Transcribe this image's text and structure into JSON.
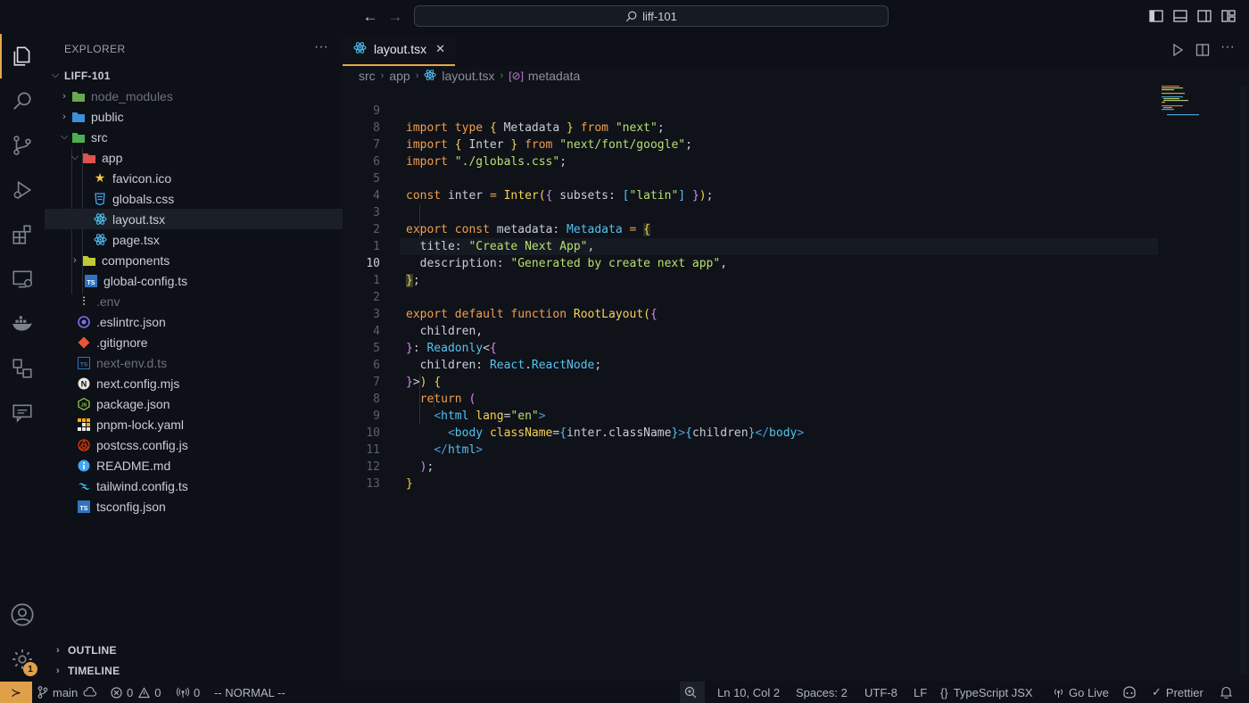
{
  "titlebar": {
    "search_text": "liff-101"
  },
  "activity": {
    "settings_badge": "1"
  },
  "explorer": {
    "title": "EXPLORER",
    "project": "LIFF-101",
    "items": [
      {
        "label": "node_modules",
        "icon": "folder-node-icon",
        "dim": true
      },
      {
        "label": "public",
        "icon": "folder-public-icon",
        "dim": false
      },
      {
        "label": "src",
        "icon": "folder-src-icon",
        "dim": false
      },
      {
        "label": "app",
        "icon": "folder-app-icon",
        "dim": false
      },
      {
        "label": "favicon.ico",
        "icon": "star-icon",
        "dim": false
      },
      {
        "label": "globals.css",
        "icon": "css-icon",
        "dim": false
      },
      {
        "label": "layout.tsx",
        "icon": "react-icon",
        "dim": false
      },
      {
        "label": "page.tsx",
        "icon": "react-icon",
        "dim": false
      },
      {
        "label": "components",
        "icon": "folder-components-icon",
        "dim": false
      },
      {
        "label": "global-config.ts",
        "icon": "typescript-icon",
        "dim": false
      },
      {
        "label": ".env",
        "icon": "env-icon",
        "dim": true
      },
      {
        "label": ".eslintrc.json",
        "icon": "eslint-icon",
        "dim": false
      },
      {
        "label": ".gitignore",
        "icon": "git-icon",
        "dim": false
      },
      {
        "label": "next-env.d.ts",
        "icon": "typescript-def-icon",
        "dim": true
      },
      {
        "label": "next.config.mjs",
        "icon": "next-icon",
        "dim": false
      },
      {
        "label": "package.json",
        "icon": "node-icon",
        "dim": false
      },
      {
        "label": "pnpm-lock.yaml",
        "icon": "pnpm-icon",
        "dim": false
      },
      {
        "label": "postcss.config.js",
        "icon": "postcss-icon",
        "dim": false
      },
      {
        "label": "README.md",
        "icon": "info-icon",
        "dim": false
      },
      {
        "label": "tailwind.config.ts",
        "icon": "tailwind-icon",
        "dim": false
      },
      {
        "label": "tsconfig.json",
        "icon": "tsconfig-icon",
        "dim": false
      }
    ],
    "outline": "OUTLINE",
    "timeline": "TIMELINE"
  },
  "editor": {
    "tab_label": "layout.tsx",
    "breadcrumb": [
      "src",
      "app",
      "layout.tsx",
      "metadata"
    ],
    "line_numbers": [
      "9",
      "8",
      "7",
      "6",
      "5",
      "4",
      "3",
      "2",
      "1",
      "10",
      "1",
      "2",
      "3",
      "4",
      "5",
      "6",
      "7",
      "8",
      "9",
      "10",
      "11",
      "12",
      "13"
    ],
    "current_line_index": 9
  },
  "status": {
    "branch": "main",
    "errors": "0",
    "warnings": "0",
    "ports": "0",
    "mode": "-- NORMAL --",
    "position": "Ln 10, Col 2",
    "spaces": "Spaces: 2",
    "encoding": "UTF-8",
    "eol": "LF",
    "language": "TypeScript JSX",
    "golive": "Go Live",
    "prettier": "Prettier"
  }
}
